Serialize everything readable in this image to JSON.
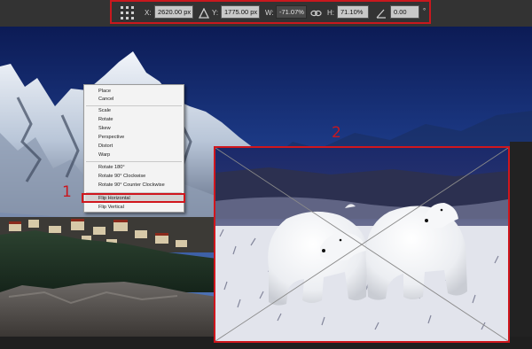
{
  "toolbar": {
    "x_label": "X:",
    "x_value": "2620.00 px",
    "delta_icon": "delta-icon",
    "y_label": "Y:",
    "y_value": "1775.00 px",
    "w_label": "W:",
    "w_value": "-71.07%",
    "link_icon": "link-icon",
    "h_label": "H:",
    "h_value": "71.10%",
    "angle_icon": "angle-icon",
    "angle_value": "0.00",
    "degree_unit": "°"
  },
  "context_menu": {
    "items": [
      {
        "label": "Place"
      },
      {
        "label": "Cancel"
      },
      {
        "label": "Scale"
      },
      {
        "label": "Rotate"
      },
      {
        "label": "Skew"
      },
      {
        "label": "Perspective"
      },
      {
        "label": "Distort"
      },
      {
        "label": "Warp"
      },
      {
        "label": "Rotate 180°"
      },
      {
        "label": "Rotate 90° Clockwise"
      },
      {
        "label": "Rotate 90° Counter Clockwise"
      },
      {
        "label": "Flip Horizontal"
      },
      {
        "label": "Flip Vertical"
      }
    ],
    "highlighted": "Flip Horizontal"
  },
  "callouts": {
    "first": "1",
    "second": "2"
  },
  "colors": {
    "annotation_red": "#c9181e",
    "sky_top": "#0e1f5c",
    "menu_bg": "#f3f3f3"
  }
}
